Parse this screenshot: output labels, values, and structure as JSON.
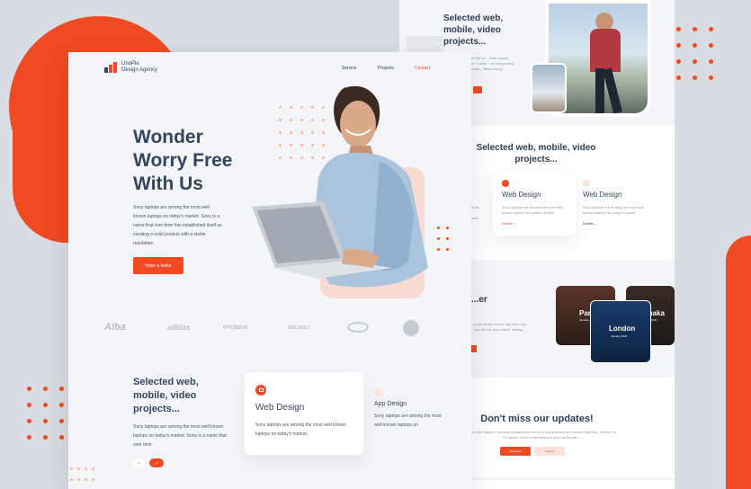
{
  "back_page": {
    "header_title": "Selected web, mobile, video projects...",
    "header_text": "...s we will be ...rther twenty years? I mean ...ar thought that you could ...ffered today.",
    "section_title": "Selected web, mobile, video projects...",
    "card1": {
      "title": "Web Design",
      "text": "Sony laptops are among the most well known laptops on today's market.",
      "link": "Details →"
    },
    "card2": {
      "title": "Web Design",
      "text": "Sony laptops are among the most well known laptops on today's market.",
      "link": "Details →"
    },
    "left_card_text": "...re most well ...market.",
    "travel_title": "...er",
    "travel_text": "...g the same routine day after day, ...you did the day before, having",
    "cities": [
      {
        "name": "Par...",
        "date": "January ..."
      },
      {
        "name": "London",
        "date": "January 2018"
      },
      {
        "name": "...haka",
        "date": "...ober 2018"
      }
    ],
    "updates_title": "Don't miss our updates!",
    "updates_text": "...ay for the latest in wireless headphones for your employment and private listening, whether to TV stereo, home entertainment such as theater.",
    "subscribe_label": "Subscribe",
    "contact_label": "Contact"
  },
  "front_page": {
    "brand_name": "UnoPie",
    "brand_sub": "Design Agency",
    "nav": [
      "Service",
      "Projects",
      "Contact"
    ],
    "hero_title_lines": [
      "Wonder",
      "Worry Free",
      "With Us"
    ],
    "hero_text": "Sony laptops are among the most well known laptops on today's market. Sony is a name that over time has established itself as creating a solid product with a stellar reputation.",
    "hero_button": "Have a looke",
    "partner_logos": [
      "Alba",
      "adidas",
      "HYUNDAI",
      "RED BULL",
      "logo",
      "logo"
    ],
    "projects_title": "Selected web, mobile, video projects...",
    "projects_text": "Sony laptops are among the most well known laptops on today's market. Sony is a name that over time.",
    "card_web": {
      "title": "Web Design",
      "text": "Sony laptops are among the most well known laptops on today's market."
    },
    "card_app": {
      "title": "App Design",
      "text": "Sony laptops are among the most well known laptops on"
    },
    "prev_label": "←",
    "next_label": "→"
  },
  "colors": {
    "accent": "#f04a22",
    "navy": "#34465f",
    "pale": "#f7dbd2"
  }
}
